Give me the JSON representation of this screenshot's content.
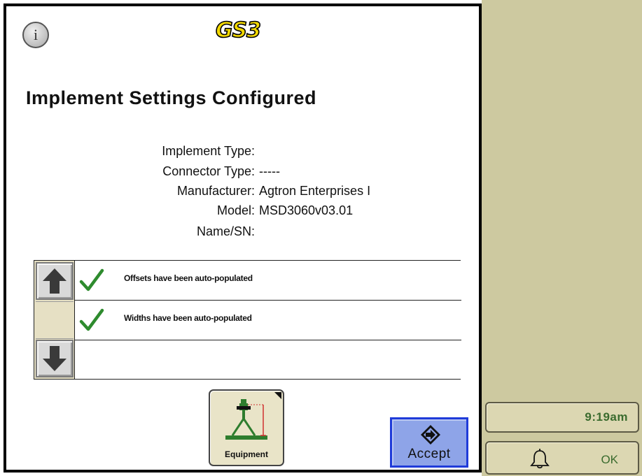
{
  "header": {
    "logo_text": "GS3",
    "info_glyph": "i"
  },
  "title": "Implement Settings Configured",
  "details": [
    {
      "key": "Implement Type:",
      "value": ""
    },
    {
      "key": "Connector Type:",
      "value": "-----"
    },
    {
      "key": "Manufacturer:",
      "value": "Agtron Enterprises I"
    },
    {
      "key": "Model:",
      "value": "MSD3060v03.01"
    },
    {
      "key": "Name/SN:",
      "value": ""
    }
  ],
  "messages": [
    {
      "text": "Offsets have been auto-populated",
      "icon": "checkmark-icon"
    },
    {
      "text": "Widths have been auto-populated",
      "icon": "checkmark-icon"
    },
    {
      "text": "",
      "icon": ""
    }
  ],
  "buttons": {
    "equipment_label": "Equipment",
    "accept_label": "Accept"
  },
  "side": {
    "clock": "9:19am",
    "alarm_label": "OK"
  },
  "colors": {
    "accent_green": "#2e8b2e",
    "accept_fill": "#8ea4e8",
    "accept_border": "#1f3bd9",
    "panel_tan": "#cdc9a0",
    "logo_yellow": "#f2d800"
  }
}
